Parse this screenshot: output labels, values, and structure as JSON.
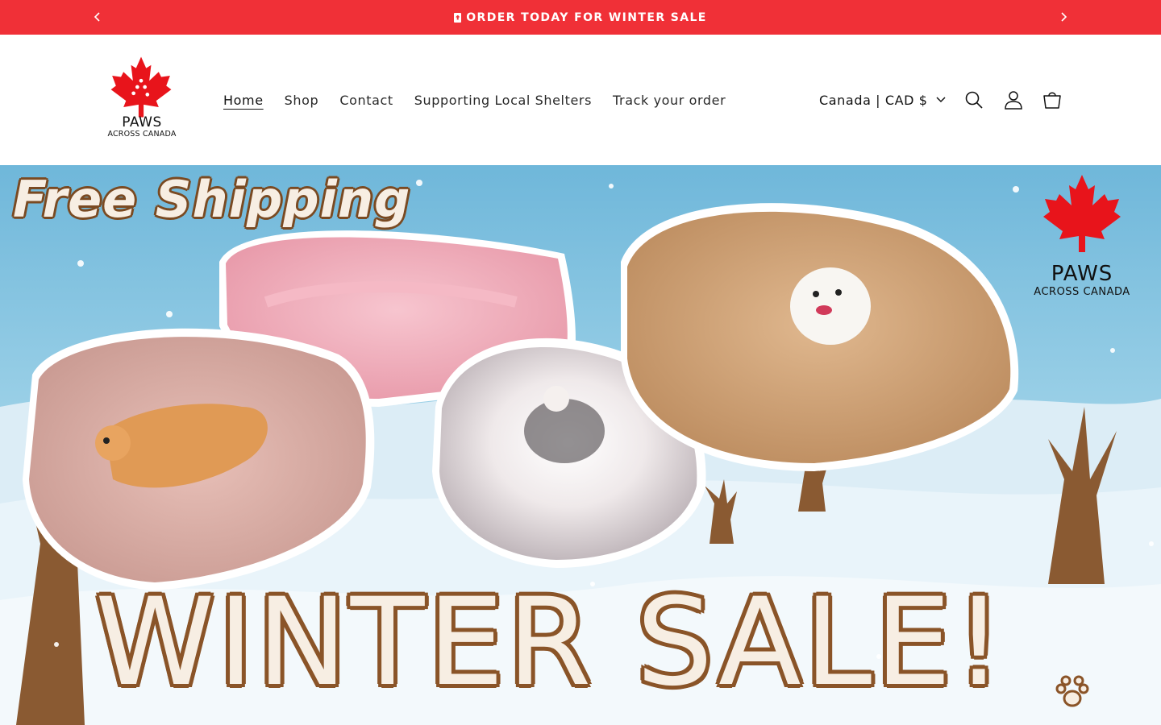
{
  "announcement": {
    "message": "ORDER TODAY FOR WINTER SALE",
    "prev_icon": "chevron-left-icon",
    "next_icon": "chevron-right-icon",
    "background": "#f03037"
  },
  "header": {
    "logo": {
      "brand": "PAWS",
      "tagline": "ACROSS CANADA"
    },
    "nav": [
      {
        "label": "Home",
        "active": true
      },
      {
        "label": "Shop",
        "active": false
      },
      {
        "label": "Contact",
        "active": false
      },
      {
        "label": "Supporting Local Shelters",
        "active": false
      },
      {
        "label": "Track your order",
        "active": false
      }
    ],
    "locale_selector": "Canada | CAD $",
    "icons": [
      "search-icon",
      "account-icon",
      "cart-icon"
    ]
  },
  "hero": {
    "headline_top": "Free Shipping",
    "headline_bottom": "WINTER SALE!",
    "brand": "PAWS",
    "brand_tagline": "ACROSS CANADA",
    "colors": {
      "sky": "#8fcbe3",
      "snow": "#eef6fb",
      "lettering_outline": "#8a5428"
    }
  }
}
